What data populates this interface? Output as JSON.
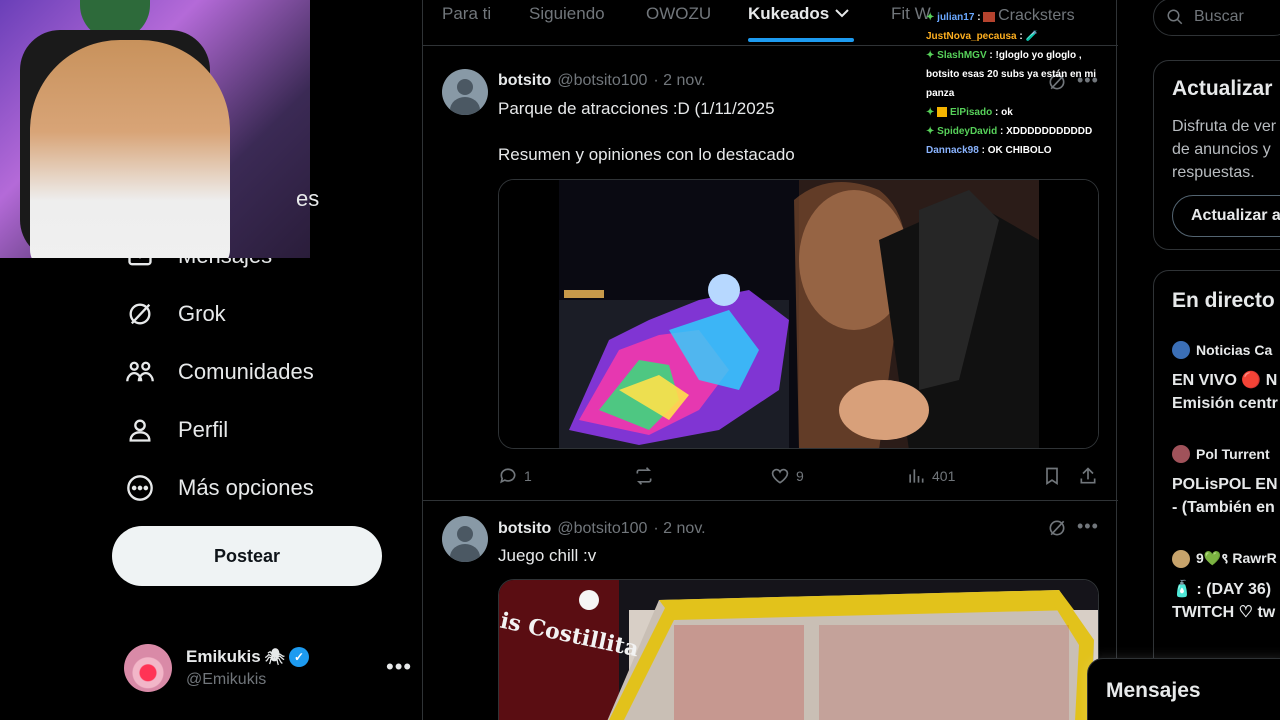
{
  "sidebar": {
    "items": [
      {
        "label": "Mensajes",
        "icon": "envelope-icon"
      },
      {
        "label": "Grok",
        "icon": "grok-icon"
      },
      {
        "label": "Comunidades",
        "icon": "communities-icon"
      },
      {
        "label": "Perfil",
        "icon": "profile-icon"
      },
      {
        "label": "Más opciones",
        "icon": "more-options-icon"
      }
    ],
    "partial_label": "es",
    "post_button": "Postear",
    "account": {
      "name": "Emikukis",
      "handle": "@Emikukis",
      "more": "•••"
    }
  },
  "tabs": {
    "items": [
      "Para ti",
      "Siguiendo",
      "OWOZU",
      "Kukeados",
      "Fit W"
    ],
    "active": "Kukeados",
    "chevron": "⌄"
  },
  "posts": [
    {
      "name": "botsito",
      "handle": "@botsito100",
      "date": "· 2 nov.",
      "text": "Parque de atracciones :D (1/11/2025\n\nResumen y opiniones con lo destacado",
      "replies": "1",
      "likes": "9",
      "views": "401"
    },
    {
      "name": "botsito",
      "handle": "@botsito100",
      "date": "· 2 nov.",
      "text": "Juego chill :v",
      "media_sign": "is Costillita"
    }
  ],
  "search": {
    "placeholder": "Buscar"
  },
  "right": {
    "update_card": {
      "title": "Actualizar",
      "text": "Disfruta de ver\nde anuncios y\nrespuestas.",
      "button": "Actualizar a"
    },
    "live_card": {
      "title": "En directo",
      "items": [
        {
          "user": "Noticias Ca",
          "title": "EN VIVO 🔴 N\nEmisión centr",
          "color": "#3b6fb6"
        },
        {
          "user": "Pol Turrent",
          "title": "POLisPOL EN\n- (También en",
          "color": "#a0525a"
        },
        {
          "user": "9💚९ RawrR",
          "title": "🧴 : (DAY 36)\nTWITCH ♡ tw",
          "color": "#c7a36b"
        }
      ]
    }
  },
  "chat": [
    {
      "user": "julian17",
      "msg": ":",
      "user_color": "#6aa8ff",
      "tail": "Cracksters"
    },
    {
      "user": "JustNova_pecausa",
      "msg": ":",
      "user_color": "#ffb020"
    },
    {
      "user": "SlashMGV",
      "msg": ": !gloglo yo gloglo , botsito esas 20 subs ya están en mi panza",
      "user_color": "#57d15a"
    },
    {
      "user": "ElPisado",
      "msg": ": ok",
      "user_color": "#57d15a"
    },
    {
      "user": "SpideyDavid",
      "msg": ": XDDDDDDDDDDD",
      "user_color": "#57d15a"
    },
    {
      "user": "Dannack98",
      "msg": ": OK CHIBOLO",
      "user_color": "#8ab4ff"
    }
  ],
  "messages_drawer": {
    "title": "Mensajes"
  },
  "colors": {
    "accent": "#1d9bf0",
    "background": "#000000",
    "text": "#e7e9ea",
    "muted": "#71767b",
    "border": "#2f3336"
  }
}
